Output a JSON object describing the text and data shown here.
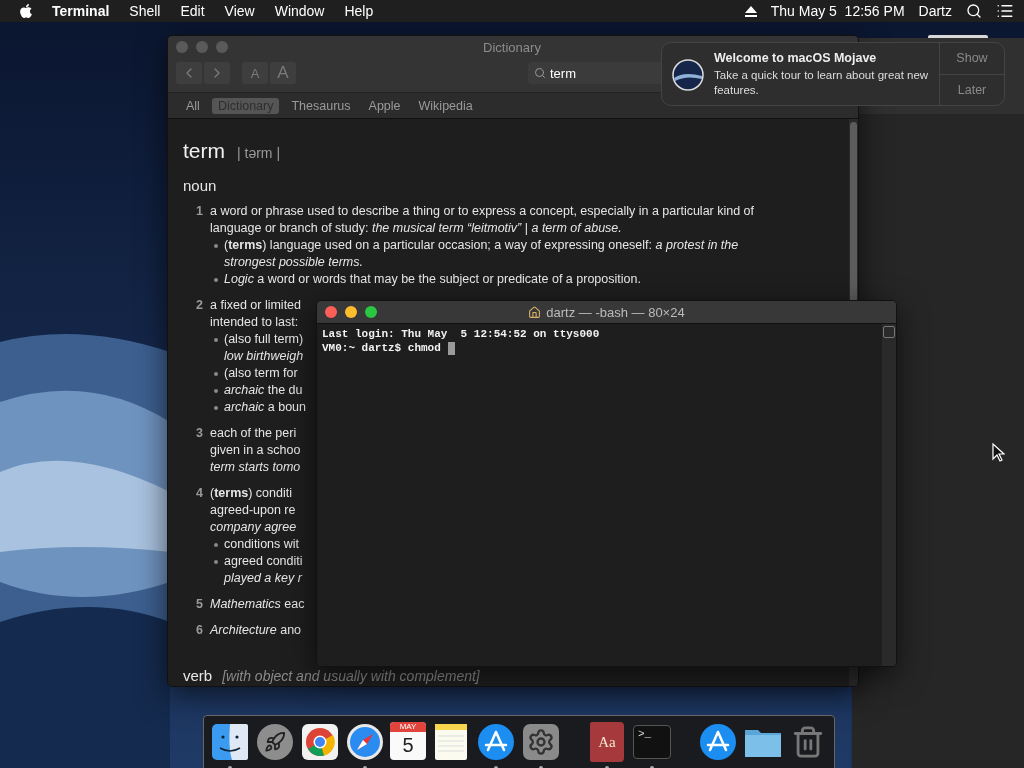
{
  "menu_bar": {
    "app": "Terminal",
    "items": [
      "Shell",
      "Edit",
      "View",
      "Window",
      "Help"
    ],
    "clock": "Thu May 5  12:56 PM",
    "user": "Dartz"
  },
  "dictionary": {
    "title": "Dictionary",
    "font_buttons": [
      "A",
      "A"
    ],
    "search": {
      "value": "term"
    },
    "sources": [
      {
        "label": "All",
        "selected": false
      },
      {
        "label": "Dictionary",
        "selected": true
      },
      {
        "label": "Thesaurus",
        "selected": false
      },
      {
        "label": "Apple",
        "selected": false
      },
      {
        "label": "Wikipedia",
        "selected": false
      }
    ],
    "headword": "term",
    "pronunciation": "| tərm |",
    "part_of_speech": "noun",
    "senses": [
      {
        "number": "1",
        "lines": [
          "a word or phrase used to describe a thing or to express a concept, especially in a particular kind of",
          "language or branch of study: *the musical term “leitmotiv”* | *a term of abuse.*"
        ],
        "subsenses": [
          {
            "lines": [
              "(**terms**) language used on a particular occasion; a way of expressing oneself: *a protest in the*",
              "*strongest possible terms.*"
            ]
          },
          {
            "lines": [
              "*Logic* a word or words that may be the subject or predicate of a proposition."
            ]
          }
        ]
      },
      {
        "number": "2",
        "lines": [
          "a fixed or limited",
          "intended to last:"
        ],
        "subsenses": [
          {
            "lines": [
              "(also full term)",
              "*low birthweigh*"
            ]
          },
          {
            "lines": [
              "(also term for"
            ]
          },
          {
            "lines": [
              "*archaic* the du"
            ]
          },
          {
            "lines": [
              "*archaic* a boun"
            ]
          }
        ]
      },
      {
        "number": "3",
        "lines": [
          "each of the peri",
          "given in a schoo",
          "*term starts tomo*"
        ]
      },
      {
        "number": "4",
        "lines": [
          "(**terms**) conditi",
          "agreed-upon re",
          "*company agree*"
        ],
        "subsenses": [
          {
            "lines": [
              "conditions wit"
            ]
          },
          {
            "lines": [
              "agreed conditi",
              "*played a key r*"
            ]
          }
        ]
      },
      {
        "number": "5",
        "lines": [
          "*Mathematics* eac"
        ]
      },
      {
        "number": "6",
        "lines": [
          "*Architecture* ano"
        ]
      }
    ],
    "verb": {
      "label": "verb",
      "note": "[with object and usually with complement]"
    }
  },
  "terminal": {
    "title": "dartz — -bash — 80×24",
    "lines": [
      "Last login: Thu May  5 12:54:52 on ttys000",
      "VM0:~ dartz$ chmod"
    ]
  },
  "notification": {
    "title": "Welcome to macOS Mojave",
    "body": "Take a quick tour to learn about great new features.",
    "actions": [
      "Show",
      "Later"
    ]
  },
  "dock": {
    "items": [
      {
        "kind": "finder",
        "running": true
      },
      {
        "kind": "rocket",
        "running": false
      },
      {
        "kind": "browser",
        "running": false
      },
      {
        "kind": "compass",
        "running": true
      },
      {
        "kind": "calendar",
        "month": "MAY",
        "day": "5",
        "running": false
      },
      {
        "kind": "notes",
        "running": false
      },
      {
        "kind": "store",
        "running": true
      },
      {
        "kind": "gear",
        "running": true
      },
      {
        "kind": "separator"
      },
      {
        "kind": "book",
        "glyph": "Aa",
        "running": true
      },
      {
        "kind": "console",
        "glyph": ">_",
        "running": true
      },
      {
        "kind": "separator"
      },
      {
        "kind": "store",
        "running": false
      },
      {
        "kind": "folder",
        "running": false
      },
      {
        "kind": "trash",
        "running": false
      }
    ]
  }
}
